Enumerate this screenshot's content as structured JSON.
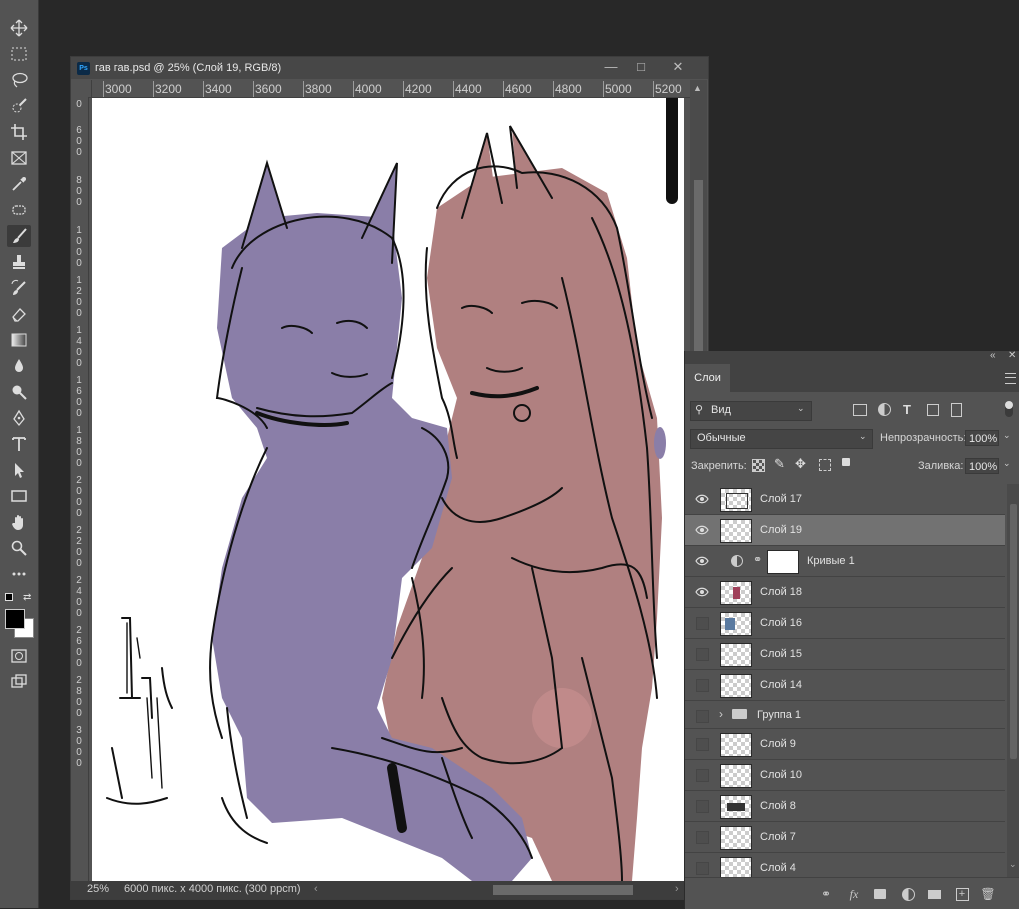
{
  "document": {
    "title": "гав гав.psd @ 25% (Слой 19, RGB/8)",
    "ps_badge": "Ps",
    "zoom": "25%",
    "info": "6000 пикс. x 4000 пикс. (300 ppcm)",
    "ruler_h": [
      "3000",
      "3200",
      "3400",
      "3600",
      "3800",
      "4000",
      "4200",
      "4400",
      "4600",
      "4800",
      "5000",
      "5200"
    ],
    "ruler_v": [
      "0",
      "600",
      "800",
      "1000",
      "1200",
      "1400",
      "1600",
      "1800",
      "2000",
      "2200",
      "2400",
      "2600",
      "2800",
      "3000"
    ]
  },
  "toolbar": {
    "tools": [
      "move-tool",
      "marquee-tool",
      "lasso-tool",
      "quick-select-tool",
      "crop-tool",
      "frame-tool",
      "eyedropper-tool",
      "healing-tool",
      "brush-tool",
      "stamp-tool",
      "history-brush-tool",
      "eraser-tool",
      "gradient-tool",
      "blur-tool",
      "dodge-tool",
      "pen-tool",
      "type-tool",
      "path-select-tool",
      "shape-tool",
      "hand-tool",
      "zoom-tool",
      "more-tools"
    ],
    "active_tool": "brush-tool",
    "foreground": "#000000",
    "background": "#ffffff"
  },
  "layers_panel": {
    "tab_label": "Слои",
    "filter_label": "Вид",
    "blend_mode": "Обычные",
    "opacity_label": "Непрозрачность:",
    "opacity_value": "100%",
    "lock_label": "Закрепить:",
    "fill_label": "Заливка:",
    "fill_value": "100%",
    "layers": [
      {
        "name": "Слой 17",
        "visible": true,
        "selected": false
      },
      {
        "name": "Слой 19",
        "visible": true,
        "selected": true
      },
      {
        "name": "Кривые 1",
        "visible": true,
        "selected": false
      },
      {
        "name": "Слой 18",
        "visible": true,
        "selected": false
      },
      {
        "name": "Слой 16",
        "visible": false,
        "selected": false
      },
      {
        "name": "Слой 15",
        "visible": false,
        "selected": false
      },
      {
        "name": "Слой 14",
        "visible": false,
        "selected": false
      },
      {
        "name": "Группа 1",
        "visible": false,
        "selected": false
      },
      {
        "name": "Слой 9",
        "visible": false,
        "selected": false
      },
      {
        "name": "Слой 10",
        "visible": false,
        "selected": false
      },
      {
        "name": "Слой 8",
        "visible": false,
        "selected": false
      },
      {
        "name": "Слой 7",
        "visible": false,
        "selected": false
      },
      {
        "name": "Слой 4",
        "visible": false,
        "selected": false
      }
    ],
    "bottom_fx": "fx"
  },
  "colors": {
    "purple_fill": "#8a7ea8",
    "pink_fill": "#b08080"
  }
}
